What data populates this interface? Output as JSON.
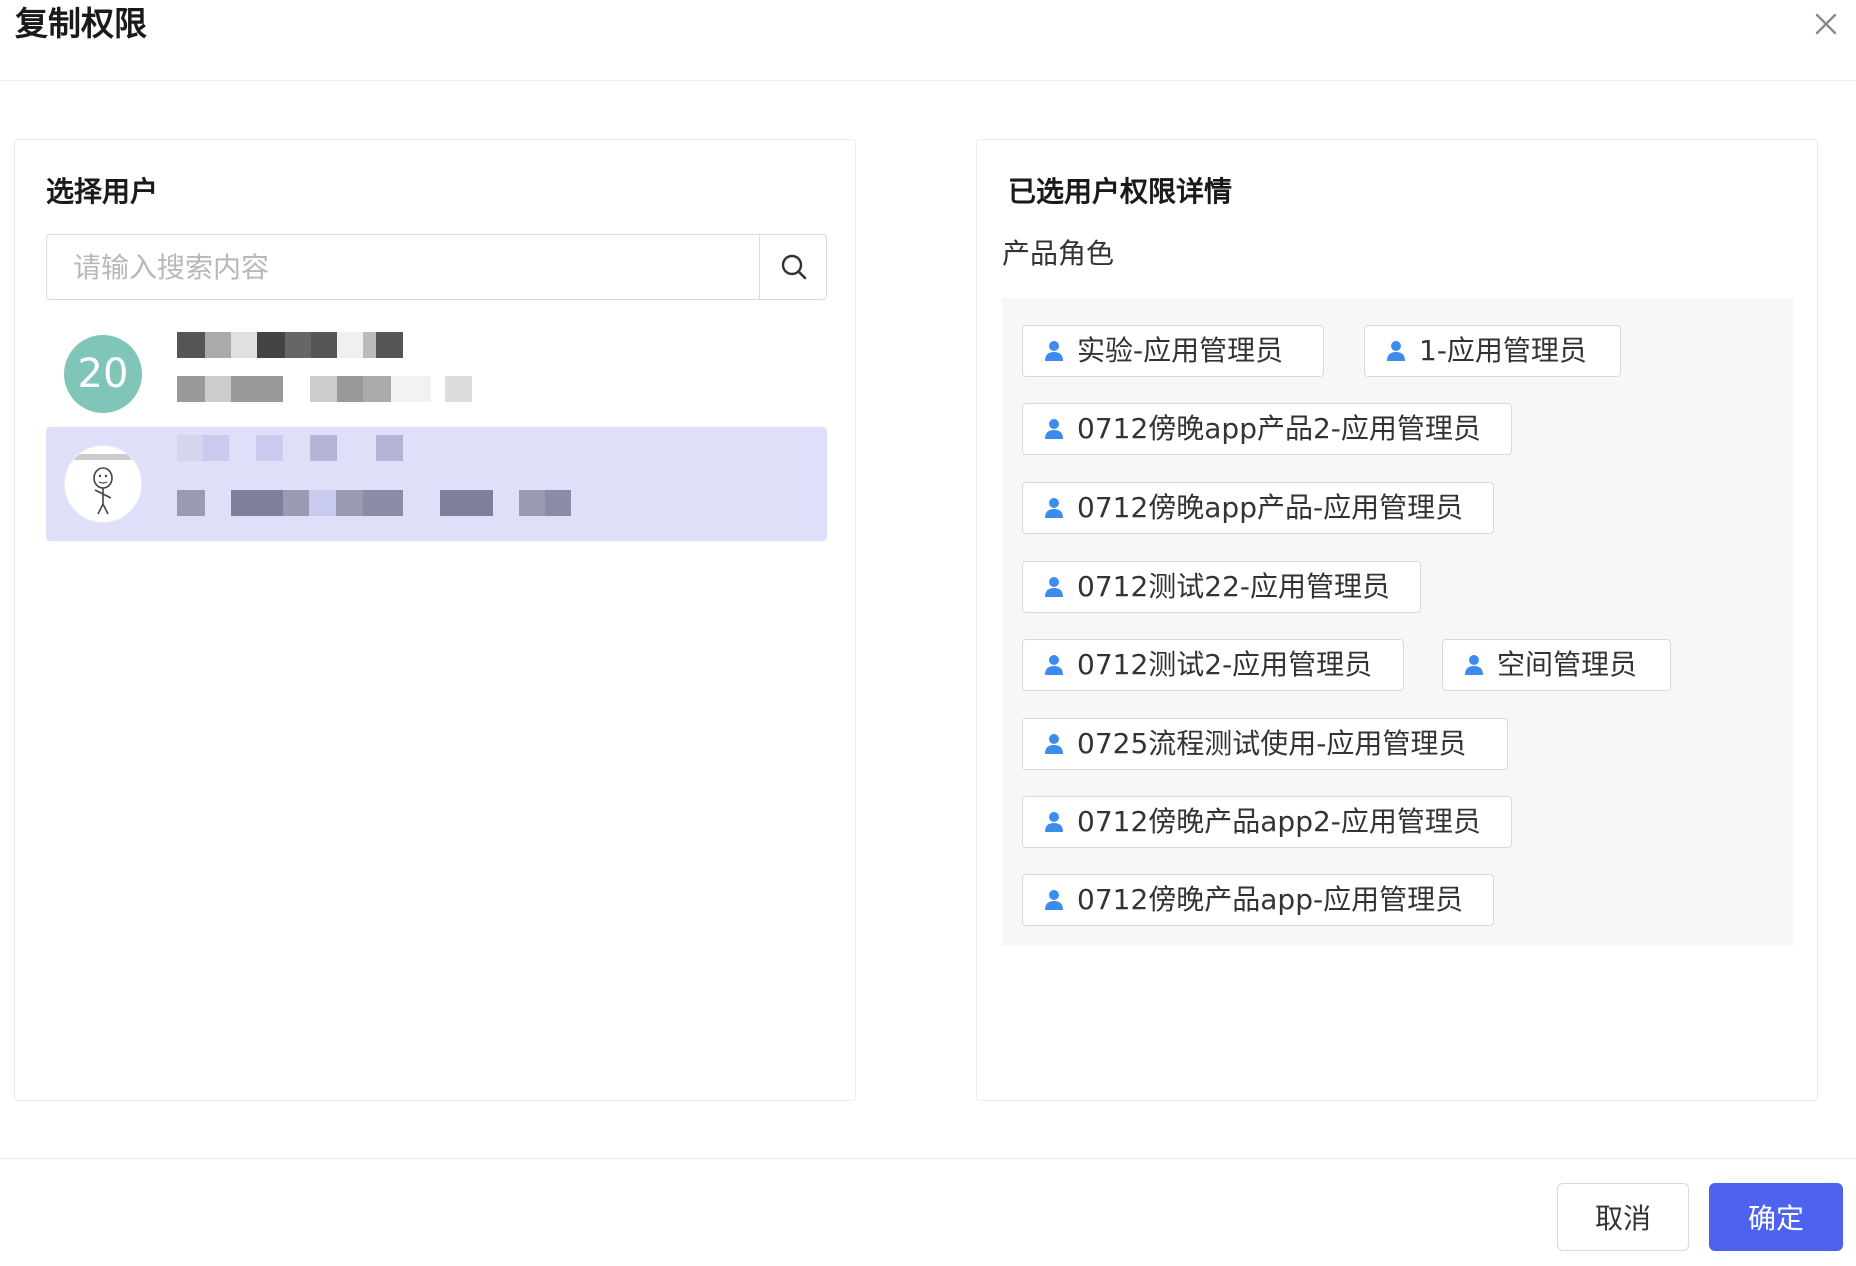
{
  "dialog": {
    "title": "复制权限",
    "close_icon": "close-icon"
  },
  "left_panel": {
    "title": "选择用户",
    "search": {
      "placeholder": "请输入搜索内容",
      "value": "",
      "icon": "search-icon"
    },
    "users": [
      {
        "avatar_text": "20",
        "avatar_color": "#7fc6b9",
        "selected": false,
        "name": "",
        "detail": ""
      },
      {
        "avatar_text": "",
        "avatar_icon": "cartoon-avatar-icon",
        "selected": true,
        "name": "",
        "detail": ""
      }
    ]
  },
  "right_panel": {
    "title": "已选用户权限详情",
    "section_label": "产品角色",
    "role_icon": "user-icon",
    "role_icon_color": "#3c8cf0",
    "roles": [
      "实验-应用管理员",
      "1-应用管理员",
      "0712傍晚app产品2-应用管理员",
      "0712傍晚app产品-应用管理员",
      "0712测试22-应用管理员",
      "0712测试2-应用管理员",
      "空间管理员",
      "0725流程测试使用-应用管理员",
      "0712傍晚产品app2-应用管理员",
      "0712傍晚产品app-应用管理员"
    ]
  },
  "footer": {
    "cancel_label": "取消",
    "confirm_label": "确定",
    "primary_color": "#4d63f0"
  }
}
